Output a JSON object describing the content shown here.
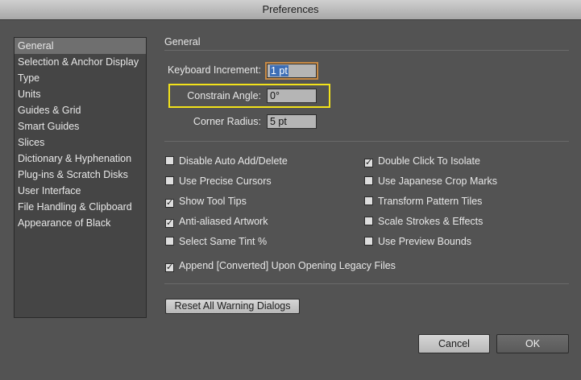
{
  "window": {
    "title": "Preferences"
  },
  "sidebar": {
    "items": [
      {
        "label": "General",
        "selected": true
      },
      {
        "label": "Selection & Anchor Display"
      },
      {
        "label": "Type"
      },
      {
        "label": "Units"
      },
      {
        "label": "Guides & Grid"
      },
      {
        "label": "Smart Guides"
      },
      {
        "label": "Slices"
      },
      {
        "label": "Dictionary & Hyphenation"
      },
      {
        "label": "Plug-ins & Scratch Disks"
      },
      {
        "label": "User Interface"
      },
      {
        "label": "File Handling & Clipboard"
      },
      {
        "label": "Appearance of Black"
      }
    ]
  },
  "general": {
    "section_title": "General",
    "keyboard_increment": {
      "label": "Keyboard Increment:",
      "value": "1 pt"
    },
    "constrain_angle": {
      "label": "Constrain Angle:",
      "value": "0°"
    },
    "corner_radius": {
      "label": "Corner Radius:",
      "value": "5 pt"
    },
    "checkboxes": {
      "disable_auto_add_delete": {
        "label": "Disable Auto Add/Delete",
        "checked": false
      },
      "use_precise_cursors": {
        "label": "Use Precise Cursors",
        "checked": false
      },
      "show_tool_tips": {
        "label": "Show Tool Tips",
        "checked": true
      },
      "anti_aliased_artwork": {
        "label": "Anti-aliased Artwork",
        "checked": true
      },
      "select_same_tint": {
        "label": "Select Same Tint %",
        "checked": false
      },
      "double_click_to_isolate": {
        "label": "Double Click To Isolate",
        "checked": true
      },
      "use_japanese_crop_marks": {
        "label": "Use Japanese Crop Marks",
        "checked": false
      },
      "transform_pattern_tiles": {
        "label": "Transform Pattern Tiles",
        "checked": false
      },
      "scale_strokes_effects": {
        "label": "Scale Strokes & Effects",
        "checked": false
      },
      "use_preview_bounds": {
        "label": "Use Preview Bounds",
        "checked": false
      },
      "append_converted": {
        "label": "Append [Converted] Upon Opening Legacy Files",
        "checked": true
      }
    },
    "reset_warning_dialogs_label": "Reset All Warning Dialogs"
  },
  "footer": {
    "cancel_label": "Cancel",
    "ok_label": "OK"
  },
  "colors": {
    "background": "#535353",
    "highlight": "#f2e21a",
    "focus_ring": "#c78a45",
    "selection": "#3d6eb5"
  }
}
